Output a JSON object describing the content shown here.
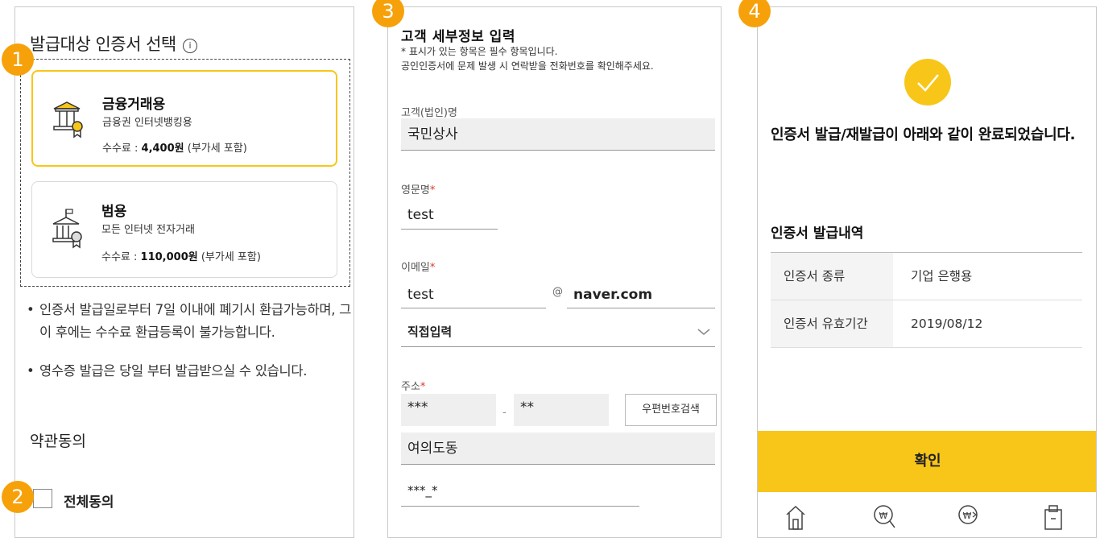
{
  "badges": [
    "1",
    "2",
    "3",
    "4"
  ],
  "panel1": {
    "title": "발급대상 인증서 선택",
    "info_icon": "ⓘ",
    "cards": [
      {
        "title": "금융거래용",
        "subtitle": "금융권 인터넷뱅킹용",
        "fee_prefix": "수수료 : ",
        "fee_amount": "4,400원",
        "fee_suffix": " (부가세 포함)",
        "selected": true
      },
      {
        "title": "범용",
        "subtitle": "모든 인터넷 전자거래",
        "fee_prefix": "수수료 : ",
        "fee_amount": "110,000원",
        "fee_suffix": " (부가세 포함)",
        "selected": false
      }
    ],
    "notes": [
      "인증서 발급일로부터 7일 이내에 폐기시 환급가능하며, 그 이 후에는 수수료 환급등록이 불가능합니다.",
      "영수증 발급은 당일 부터 발급받으실 수 있습니다."
    ],
    "terms_title": "약관동의",
    "agree_all_label": "전체동의"
  },
  "panel2": {
    "title": "고객 세부정보 입력",
    "note1": "* 표시가 있는 항목은 필수 항목입니다.",
    "note2": "공인인증서에 문제 발생 시 연락받을 전화번호를 확인해주세요.",
    "customer_name_label": "고객(법인)명",
    "customer_name_value": "국민상사",
    "english_name_label": "영문명",
    "english_name_value": "test",
    "email_label": "이메일",
    "email_id_value": "test",
    "email_at": "@",
    "email_domain_value": "naver.com",
    "email_select_value": "직접입력",
    "address_label": "주소",
    "zip1_value": "***",
    "zip_dash": "-",
    "zip2_value": "**",
    "zip_search_button": "우편번호검색",
    "address1_value": "여의도동",
    "address2_value": "***_*",
    "required_mark": "*"
  },
  "panel3": {
    "complete_message": "인증서 발급/재발급이 아래와 같이 완료되었습니다.",
    "history_title": "인증서 발급내역",
    "rows": [
      {
        "label": "인증서 종류",
        "value": "기업 은행용"
      },
      {
        "label": "인증서 유효기간",
        "value": "2019/08/12"
      }
    ],
    "confirm_button": "확인"
  },
  "colors": {
    "accent": "#f8c619",
    "badge": "#f6a10a",
    "required": "#e0352b"
  }
}
